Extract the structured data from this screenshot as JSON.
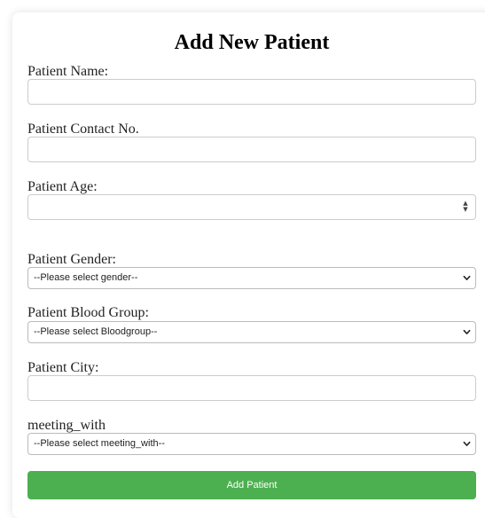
{
  "form": {
    "title": "Add New Patient",
    "fields": {
      "name": {
        "label": "Patient Name:",
        "value": ""
      },
      "contact": {
        "label": "Patient Contact No.",
        "value": ""
      },
      "age": {
        "label": "Patient Age:",
        "value": ""
      },
      "gender": {
        "label": "Patient Gender:",
        "selected": "--Please select gender--"
      },
      "blood_group": {
        "label": "Patient Blood Group:",
        "selected": "--Please select Bloodgroup--"
      },
      "city": {
        "label": "Patient City:",
        "value": ""
      },
      "meeting_with": {
        "label": "meeting_with",
        "selected": "--Please select meeting_with--"
      }
    },
    "submit_label": "Add Patient"
  },
  "icons": {
    "select": "chevron-down-icon",
    "number": "spinner-icon"
  },
  "colors": {
    "submit_bg": "#4caf50",
    "submit_text": "#ffffff",
    "input_border": "#cccccc"
  }
}
